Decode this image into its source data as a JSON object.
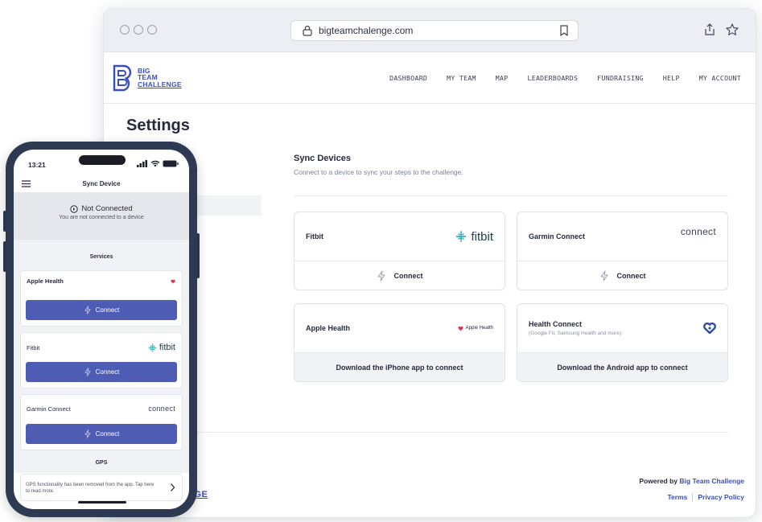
{
  "browser": {
    "url": "bigteamchalenge.com"
  },
  "site": {
    "logo": [
      "BIG",
      "TEAM",
      "CHALLENGE"
    ],
    "nav": [
      "DASHBOARD",
      "MY TEAM",
      "MAP",
      "LEADERBOARDS",
      "FUNDRAISING",
      "HELP",
      "MY ACCOUNT"
    ],
    "page_title": "Settings",
    "sync": {
      "title": "Sync Devices",
      "subtitle": "Connect to a device to sync your steps to the challenge."
    },
    "cards": [
      {
        "name": "Fitbit",
        "brand": "fitbit",
        "action": "Connect"
      },
      {
        "name": "Garmin Connect",
        "brand": "connect",
        "action": "Connect"
      },
      {
        "name": "Apple Health",
        "brand": "Apple Health",
        "action": "Download the iPhone app to connect"
      },
      {
        "name": "Health Connect",
        "desc": "(Google Fit, Samsung Health and more)",
        "action": "Download the Android app to connect"
      }
    ],
    "footer": {
      "logo_partial": "NGE",
      "powered_prefix": "Powered by ",
      "powered_link": "Big Team Challenge",
      "terms": "Terms",
      "privacy": "Privacy Policy"
    }
  },
  "phone": {
    "time": "13:21",
    "title": "Sync Device",
    "status_title": "Not Connected",
    "status_sub": "You are not connected to a device",
    "services_title": "Services",
    "services": [
      {
        "name": "Apple Health",
        "action": "Connect"
      },
      {
        "name": "Fitbit",
        "brand": "fitbit",
        "action": "Connect"
      },
      {
        "name": "Garmin Connect",
        "brand": "connect",
        "action": "Connect"
      }
    ],
    "gps_title": "GPS",
    "gps_text": "GPS functionality has been removed from the app. Tap here to read more."
  },
  "colors": {
    "accent": "#4f5cb4",
    "brand_blue": "#3a4fbf",
    "phone_frame": "#2d3a52",
    "apple_red": "#e0314b"
  }
}
